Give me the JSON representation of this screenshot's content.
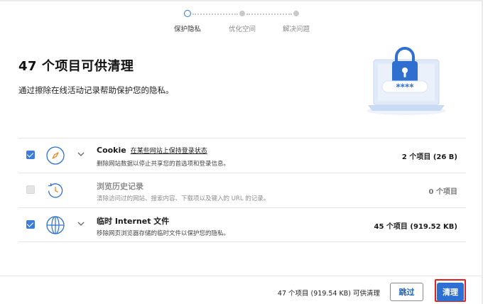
{
  "stepper": {
    "steps": [
      {
        "label": "保护隐私",
        "state": "active"
      },
      {
        "label": "优化空间",
        "state": "pending"
      },
      {
        "label": "解决问题",
        "state": "pending"
      }
    ]
  },
  "header": {
    "title": "47 个项目可供清理",
    "subtitle": "通过擦除在线活动记录帮助保护您的隐私。",
    "illustration_text": "****"
  },
  "items": [
    {
      "checked": true,
      "enabled": true,
      "icon": "compass-icon",
      "title": "Cookie",
      "link": "在某些网站上保持登录状态",
      "description": "删除网站数据以停止共享您的首选项和登录信息。",
      "count": "2 个项目 (26 B)",
      "expandable": true
    },
    {
      "checked": false,
      "enabled": false,
      "icon": "history-icon",
      "title": "浏览历史记录",
      "description": "清除访问过的网站、搜索内容、下载项以及键入的 URL 的记录。",
      "count": "0 个项目",
      "expandable": false
    },
    {
      "checked": true,
      "enabled": true,
      "icon": "globe-icon",
      "title": "临时 Internet 文件",
      "description": "移除网页浏览器存储的临时文件以保护您的隐私。",
      "count": "45 个项目 (919.52 KB)",
      "expandable": true
    }
  ],
  "footer": {
    "summary": "47 个项目 (919.54 KB) 可供清理",
    "skip_label": "跳过",
    "clean_label": "清理"
  },
  "colors": {
    "accent": "#2e6fd4",
    "highlight_outline": "#e41f1f"
  }
}
